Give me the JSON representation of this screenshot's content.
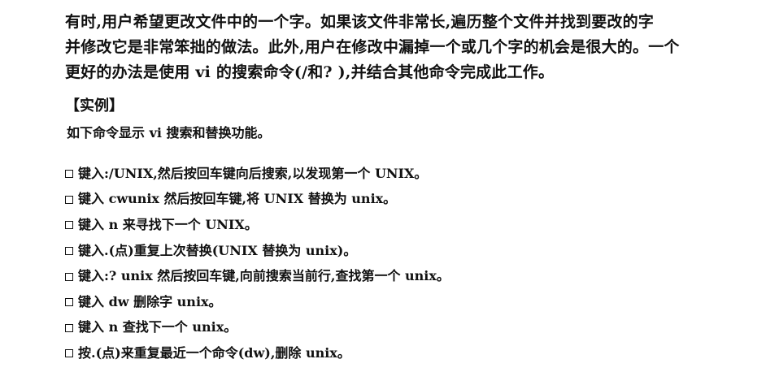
{
  "intro": {
    "lines": [
      "有时,用户希望更改文件中的一个字。如果该文件非常长,遍历整个文件并找到要改的字",
      "并修改它是非常笨拙的做法。此外,用户在修改中漏掉一个或几个字的机会是很大的。一个",
      "更好的办法是使用 vi 的搜索命令(/和? ),并结合其他命令完成此工作。"
    ]
  },
  "example": {
    "heading": "【实例】",
    "description": "如下命令显示 vi 搜索和替换功能。",
    "steps": [
      "键入:/UNIX,然后按回车键向后搜索,以发现第一个 UNIX。",
      "键入 cwunix 然后按回车键,将 UNIX 替换为 unix。",
      "键入 n 来寻找下一个 UNIX。",
      "键入.(点)重复上次替换(UNIX 替换为 unix)。",
      "键入:? unix 然后按回车键,向前搜索当前行,查找第一个 unix。",
      "键入 dw 删除字 unix。",
      "键入 n 查找下一个 unix。",
      "按.(点)来重复最近一个命令(dw),删除 unix。"
    ]
  }
}
